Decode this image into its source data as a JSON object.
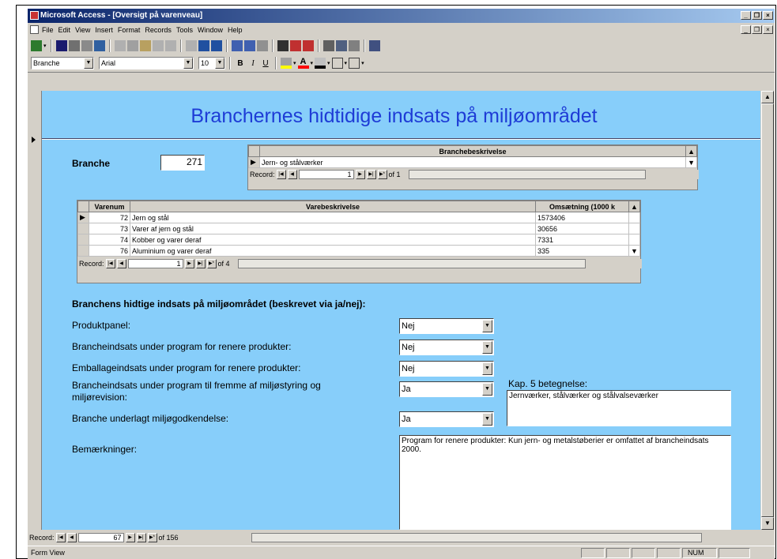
{
  "window": {
    "title": "Microsoft Access - [Oversigt på varenveau]"
  },
  "menu": [
    "File",
    "Edit",
    "View",
    "Insert",
    "Format",
    "Records",
    "Tools",
    "Window",
    "Help"
  ],
  "format_toolbar": {
    "object": "Branche",
    "font": "Arial",
    "size": "10",
    "bold": "B",
    "italic": "I",
    "underline": "U"
  },
  "form": {
    "title": "Branchernes hidtidige indsats på miljøområdet",
    "branche_label": "Branche",
    "branche_value": "271",
    "branche_sub": {
      "header": "Branchebeskrivelse",
      "value": "Jern- og stålværker",
      "record_label": "Record:",
      "record_value": "1",
      "record_of": "of 1"
    },
    "vare_sub": {
      "headers": [
        "Varenum",
        "Varebeskrivelse",
        "Omsætning (1000 k"
      ],
      "rows": [
        {
          "num": "72",
          "desc": "Jern og stål",
          "oms": "1573406"
        },
        {
          "num": "73",
          "desc": "Varer af jern og stål",
          "oms": "30656"
        },
        {
          "num": "74",
          "desc": "Kobber og varer deraf",
          "oms": "7331"
        },
        {
          "num": "76",
          "desc": "Aluminium og varer deraf",
          "oms": "335"
        }
      ],
      "record_label": "Record:",
      "record_value": "1",
      "record_of": "of 4"
    },
    "section_heading": "Branchens hidtige indsats på miljøområdet (beskrevet via ja/nej):",
    "questions": [
      {
        "label": "Produktpanel:",
        "value": "Nej"
      },
      {
        "label": "Brancheindsats under program for renere produkter:",
        "value": "Nej"
      },
      {
        "label": "Emballageindsats under program for renere produkter:",
        "value": "Nej"
      },
      {
        "label": "Brancheindsats under program til fremme af miljøstyring og miljørevision:",
        "value": "Ja"
      },
      {
        "label": "Branche underlagt miljøgodkendelse:",
        "value": "Ja"
      }
    ],
    "kap_label": "Kap. 5 betegnelse:",
    "kap_value": "Jernværker, stålværker og stålvalseværker",
    "remarks_label": "Bemærkninger:",
    "remarks_value": "Program for renere produkter: Kun jern- og metalstøberier er omfattet af brancheindsats 2000."
  },
  "main_nav": {
    "record_label": "Record:",
    "record_value": "67",
    "record_of": "of 156"
  },
  "status": {
    "text": "Form View",
    "num": "NUM"
  }
}
